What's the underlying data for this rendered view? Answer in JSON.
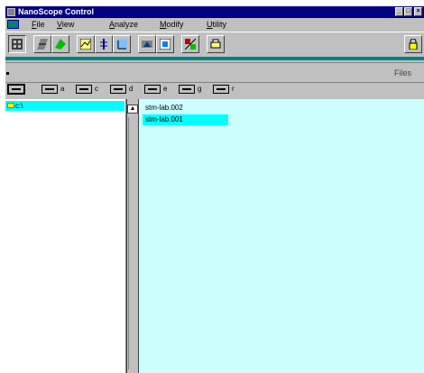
{
  "window": {
    "title": "NanoScope Control"
  },
  "window_controls": {
    "minimize": "_",
    "maximize": "□",
    "close": "×"
  },
  "menu": [
    {
      "prefix": "",
      "ul": "F",
      "rest": "ile"
    },
    {
      "prefix": "",
      "ul": "V",
      "rest": "iew"
    },
    {
      "prefix": "",
      "ul": "A",
      "rest": "nalyze"
    },
    {
      "prefix": "",
      "ul": "M",
      "rest": "odify"
    },
    {
      "prefix": "",
      "ul": "U",
      "rest": "tility"
    }
  ],
  "toolbar": {
    "icons": [
      "grid-image-icon",
      "surface-plot-icon",
      "section-icon",
      "step-icon",
      "histogram-icon",
      "zoom-icon",
      "3d-view-icon",
      "compare-icon",
      "print-icon"
    ]
  },
  "files_header": {
    "label": "Files"
  },
  "drives": [
    {
      "letter": "",
      "selected": true
    },
    {
      "letter": "a",
      "selected": false
    },
    {
      "letter": "c",
      "selected": false
    },
    {
      "letter": "d",
      "selected": false
    },
    {
      "letter": "e",
      "selected": false
    },
    {
      "letter": "g",
      "selected": false
    },
    {
      "letter": "r",
      "selected": false
    }
  ],
  "tree": {
    "item": "c:\\"
  },
  "splitter": {
    "arrow": "▲"
  },
  "files": [
    {
      "name": "stm-lab.002",
      "selected": false
    },
    {
      "name": "stm-lab.001",
      "selected": true
    }
  ],
  "colors": {
    "titlebar": "#000080",
    "selection": "#00ffff",
    "file_pane": "#ccffff",
    "accent_bar": "#008080"
  }
}
